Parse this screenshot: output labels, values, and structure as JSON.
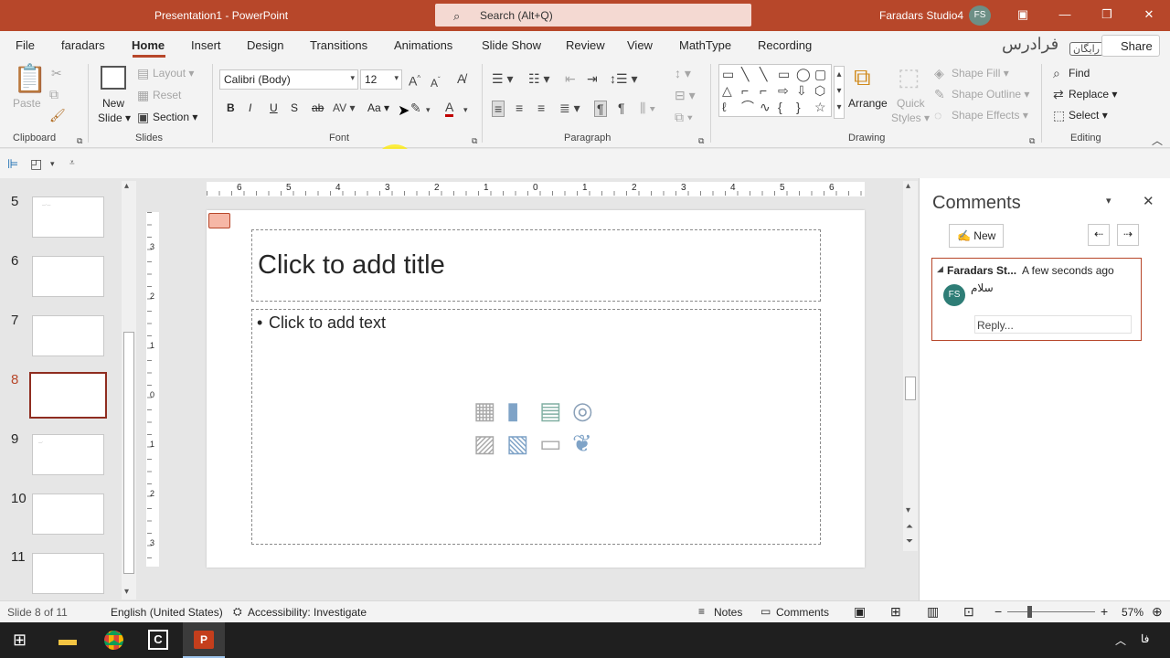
{
  "titlebar": {
    "doc_title": "Presentation1",
    "separator": " - ",
    "app_name": "PowerPoint",
    "search_placeholder": "Search (Alt+Q)",
    "user_name": "Faradars Studio4",
    "user_initials": "FS"
  },
  "tabs": [
    "File",
    "faradars",
    "Home",
    "Insert",
    "Design",
    "Transitions",
    "Animations",
    "Slide Show",
    "Review",
    "View",
    "MathType",
    "Recording"
  ],
  "active_tab": "Home",
  "share_label": "Share",
  "brand_watermark": "فرادرس",
  "brand_badge": "رایگان",
  "ribbon": {
    "clipboard": {
      "paste": "Paste",
      "group": "Clipboard"
    },
    "slides": {
      "new_slide_1": "New",
      "new_slide_2": "Slide",
      "layout": "Layout",
      "reset": "Reset",
      "section": "Section",
      "group": "Slides"
    },
    "font": {
      "font_name": "Calibri (Body)",
      "font_size": "12",
      "bold": "B",
      "italic": "I",
      "underline": "U",
      "shadow": "S",
      "strike": "ab",
      "change_case": "Aa",
      "group": "Font"
    },
    "paragraph": {
      "group": "Paragraph"
    },
    "drawing": {
      "arrange": "Arrange",
      "quick_styles_1": "Quick",
      "quick_styles_2": "Styles",
      "shape_fill": "Shape Fill",
      "shape_outline": "Shape Outline",
      "shape_effects": "Shape Effects",
      "group": "Drawing"
    },
    "editing": {
      "find": "Find",
      "replace": "Replace",
      "select": "Select",
      "group": "Editing"
    }
  },
  "thumbnails": [
    {
      "num": "5",
      "selected": false
    },
    {
      "num": "6",
      "selected": false
    },
    {
      "num": "7",
      "selected": false
    },
    {
      "num": "8",
      "selected": true
    },
    {
      "num": "9",
      "selected": false
    },
    {
      "num": "10",
      "selected": false
    },
    {
      "num": "11",
      "selected": false
    }
  ],
  "ruler": {
    "h_ticks": [
      "6",
      "5",
      "4",
      "3",
      "2",
      "1",
      "0",
      "1",
      "2",
      "3",
      "4",
      "5",
      "6"
    ],
    "v_ticks": [
      "3",
      "2",
      "1",
      "0",
      "1",
      "2",
      "3"
    ]
  },
  "slide": {
    "title_placeholder": "Click to add title",
    "body_bullet": "•",
    "body_placeholder": "Click to add text"
  },
  "comments": {
    "pane_title": "Comments",
    "new_label": "New",
    "author": "Faradars St...",
    "time": "A few seconds ago",
    "initials": "FS",
    "text": "سلام",
    "reply_placeholder": "Reply..."
  },
  "status": {
    "slide_info": "Slide 8 of 11",
    "language": "English (United States)",
    "accessibility": "Accessibility: Investigate",
    "notes": "Notes",
    "comments": "Comments",
    "zoom_minus": "−",
    "zoom_plus": "+",
    "zoom": "57%"
  },
  "colors": {
    "accent": "#b7472a",
    "selected_thumb": "#8f2d20"
  }
}
